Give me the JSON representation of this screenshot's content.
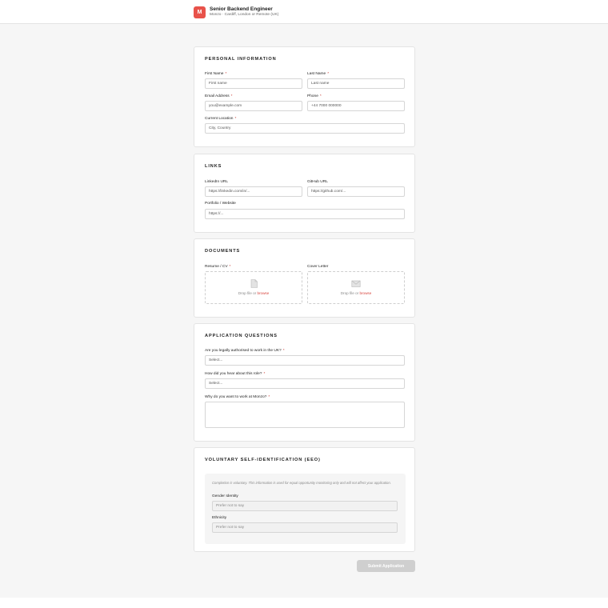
{
  "header": {
    "logo_letter": "M",
    "job_title": "Senior Backend Engineer",
    "subtitle": "Monzo · Cardiff, London or Remote (UK)"
  },
  "required_marker": "*",
  "personal": {
    "title": "PERSONAL INFORMATION",
    "first_name_label": "First Name",
    "first_name_placeholder": "First name",
    "last_name_label": "Last Name",
    "last_name_placeholder": "Last name",
    "email_label": "Email Address",
    "email_placeholder": "you@example.com",
    "phone_label": "Phone",
    "phone_placeholder": "+44 7000 000000",
    "location_label": "Current Location",
    "location_placeholder": "City, Country"
  },
  "links": {
    "title": "LINKS",
    "linkedin_label": "LinkedIn URL",
    "linkedin_placeholder": "https://linkedin.com/in/...",
    "github_label": "GitHub URL",
    "github_placeholder": "https://github.com/...",
    "portfolio_label": "Portfolio / Website",
    "portfolio_placeholder": "https://..."
  },
  "documents": {
    "title": "DOCUMENTS",
    "resume_label": "Resume / CV",
    "cover_label": "Cover Letter",
    "drop_text": "Drop file or",
    "browse_text": "browse"
  },
  "questions": {
    "title": "APPLICATION QUESTIONS",
    "q1_label": "Are you legally authorised to work in the UK?",
    "q1_value": "Select...",
    "q2_label": "How did you hear about this role?",
    "q2_value": "Select...",
    "q3_label": "Why do you want to work at Monzo?"
  },
  "eeo": {
    "title": "VOLUNTARY SELF-IDENTIFICATION (EEO)",
    "note": "Completion is voluntary. This information is used for equal opportunity monitoring only and will not affect your application.",
    "gender_label": "Gender Identity",
    "gender_value": "Prefer not to say",
    "ethnicity_label": "Ethnicity",
    "ethnicity_value": "Prefer not to say"
  },
  "submit_label": "Submit Application",
  "colors": {
    "accent": "#e8524a",
    "required": "#c8332b",
    "submit_disabled": "#cfcfcf"
  }
}
